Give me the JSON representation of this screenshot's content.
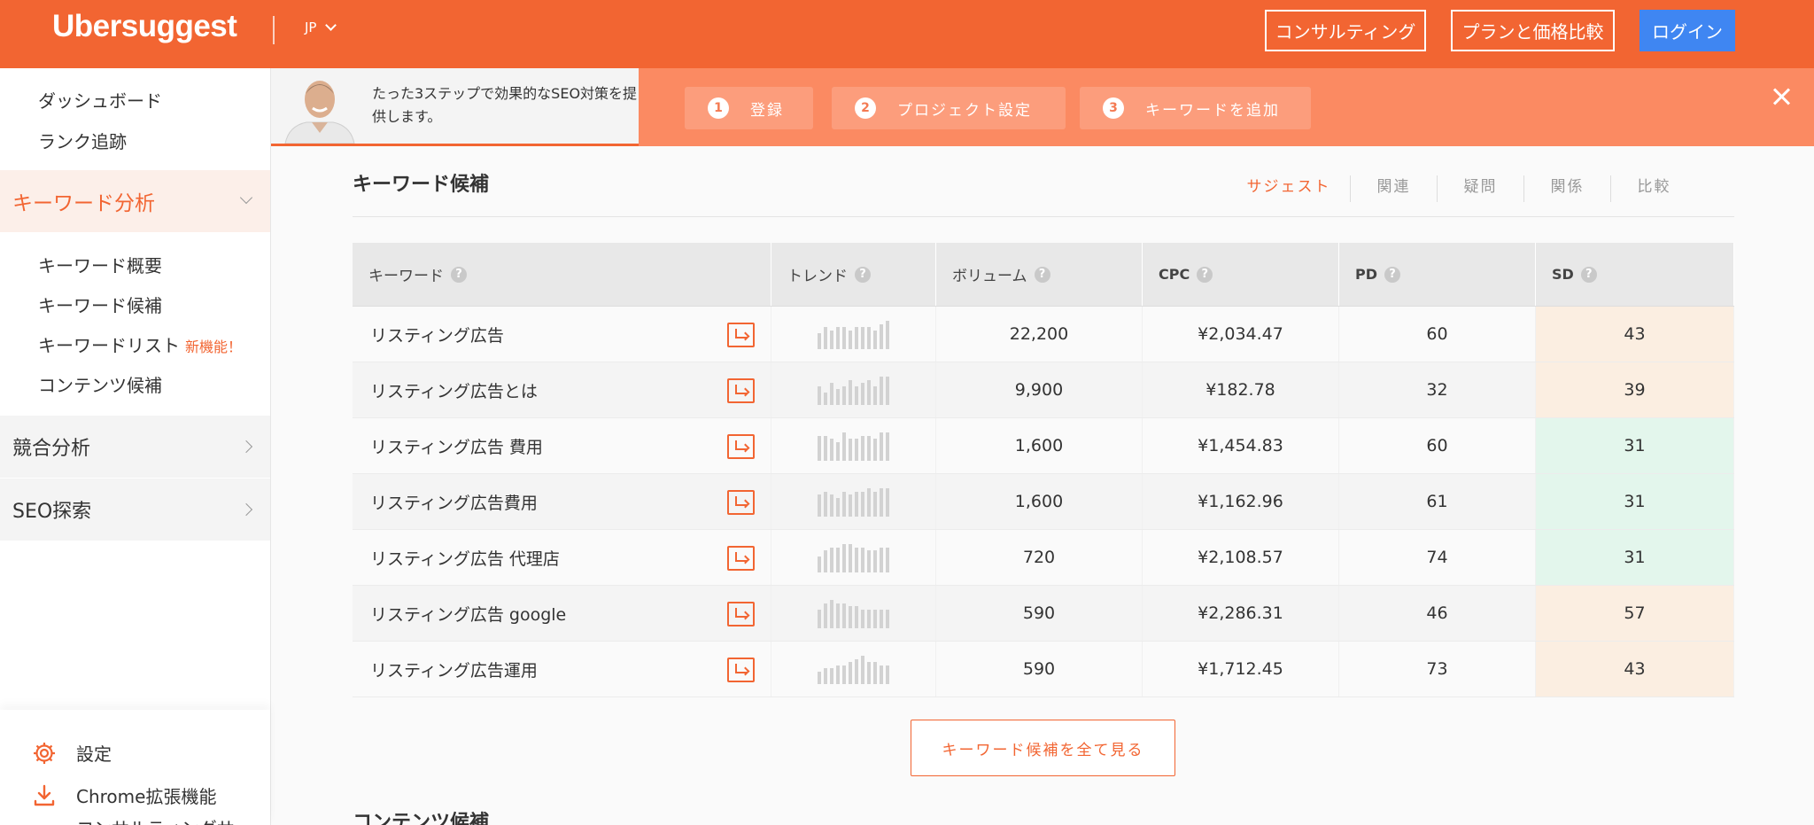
{
  "header": {
    "logo": "Ubersuggest",
    "lang": "JP",
    "consulting": "コンサルティング",
    "plans": "プランと価格比較",
    "login": "ログイン"
  },
  "sidebar": {
    "dashboard": "ダッシュボード",
    "rank_tracking": "ランク追跡",
    "keyword_analysis": "キーワード分析",
    "keyword_overview": "キーワード概要",
    "keyword_ideas": "キーワード候補",
    "keyword_lists": "キーワードリスト",
    "new_badge": "新機能！",
    "content_ideas": "コンテンツ候補",
    "competitive_analysis": "競合分析",
    "seo_explore": "SEO探索",
    "settings": "設定",
    "chrome_ext": "Chrome拡張機能",
    "consulting_partial": "コンサルティングサ"
  },
  "banner": {
    "intro": "たった3ステップで効果的なSEO対策を提供します。",
    "steps": [
      {
        "num": "1",
        "label": "登録"
      },
      {
        "num": "2",
        "label": "プロジェクト設定"
      },
      {
        "num": "3",
        "label": "キーワードを追加"
      }
    ]
  },
  "section": {
    "title": "キーワード候補",
    "tabs": [
      "サジェスト",
      "関連",
      "疑問",
      "関係",
      "比較"
    ],
    "active_tab": "サジェスト"
  },
  "table": {
    "headers": {
      "keyword": "キーワード",
      "trend": "トレンド",
      "volume": "ボリューム",
      "cpc": "CPC",
      "pd": "PD",
      "sd": "SD"
    },
    "help_glyph": "?",
    "rows": [
      {
        "keyword": "リスティング広告",
        "volume": "22,200",
        "cpc": "¥2,034.47",
        "pd": "60",
        "sd": "43",
        "sd_level": "orange",
        "trend": [
          5,
          7,
          6,
          7,
          7,
          6,
          7,
          7,
          7,
          6,
          8,
          9
        ]
      },
      {
        "keyword": "リスティング広告とは",
        "volume": "9,900",
        "cpc": "¥182.78",
        "pd": "32",
        "sd": "39",
        "sd_level": "orange",
        "trend": [
          6,
          4,
          7,
          5,
          6,
          8,
          6,
          7,
          8,
          6,
          9,
          9
        ]
      },
      {
        "keyword": "リスティング広告 費用",
        "volume": "1,600",
        "cpc": "¥1,454.83",
        "pd": "60",
        "sd": "31",
        "sd_level": "green",
        "trend": [
          8,
          8,
          7,
          6,
          9,
          7,
          7,
          8,
          8,
          7,
          9,
          9
        ]
      },
      {
        "keyword": "リスティング広告費用",
        "volume": "1,600",
        "cpc": "¥1,162.96",
        "pd": "61",
        "sd": "31",
        "sd_level": "green",
        "trend": [
          7,
          8,
          7,
          6,
          8,
          7,
          8,
          8,
          9,
          8,
          9,
          9
        ]
      },
      {
        "keyword": "リスティング広告 代理店",
        "volume": "720",
        "cpc": "¥2,108.57",
        "pd": "74",
        "sd": "31",
        "sd_level": "green",
        "trend": [
          5,
          7,
          8,
          8,
          9,
          9,
          8,
          8,
          7,
          7,
          8,
          8
        ]
      },
      {
        "keyword": "リスティング広告 google",
        "volume": "590",
        "cpc": "¥2,286.31",
        "pd": "46",
        "sd": "57",
        "sd_level": "orange",
        "trend": [
          6,
          8,
          9,
          8,
          8,
          7,
          7,
          6,
          6,
          6,
          6,
          6
        ]
      },
      {
        "keyword": "リスティング広告運用",
        "volume": "590",
        "cpc": "¥1,712.45",
        "pd": "73",
        "sd": "43",
        "sd_level": "orange",
        "trend": [
          4,
          5,
          5,
          6,
          6,
          7,
          8,
          9,
          7,
          7,
          6,
          6
        ]
      }
    ]
  },
  "more_button": "キーワード候補を全て見る",
  "next_section": "コンテンツ候補",
  "colors": {
    "brand": "#f26532",
    "login": "#3f86f2",
    "sd_orange": "#fbeee1",
    "sd_green": "#e3f6ec"
  }
}
